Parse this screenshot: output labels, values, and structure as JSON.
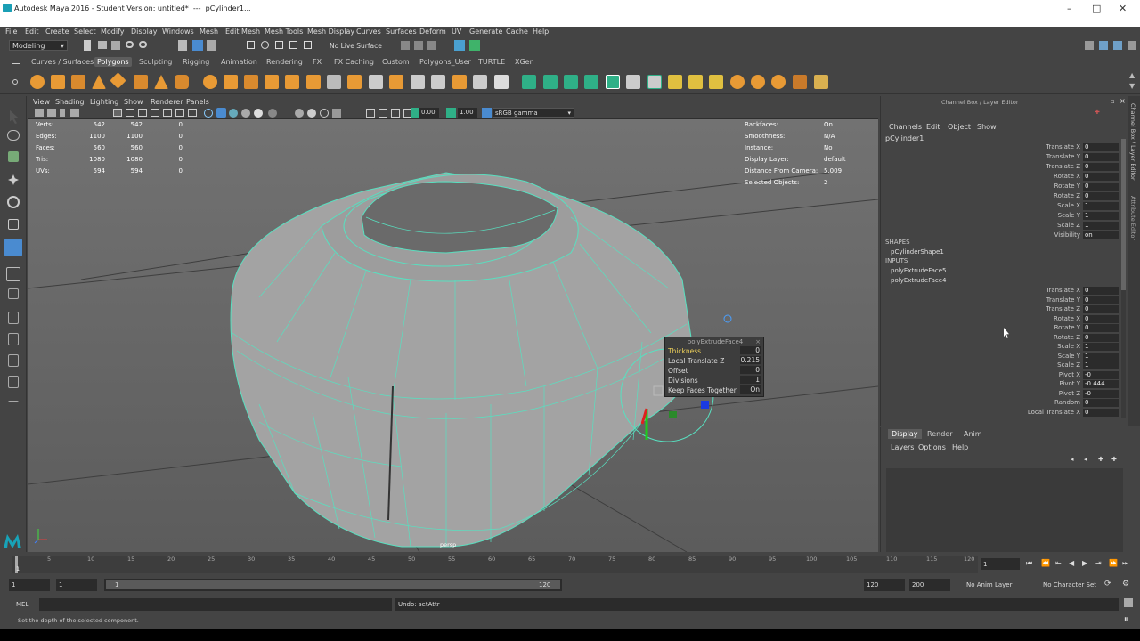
{
  "title": {
    "app": "Autodesk Maya 2016 - Student Version: untitled*",
    "sep": "---",
    "object": "pCylinder1..."
  },
  "window_controls": {
    "min": "–",
    "max": "□",
    "close": "✕"
  },
  "menu": [
    "File",
    "Edit",
    "Create",
    "Select",
    "Modify",
    "Display",
    "Windows",
    "Mesh",
    "Edit Mesh",
    "Mesh Tools",
    "Mesh Display",
    "Curves",
    "Surfaces",
    "Deform",
    "UV",
    "Generate",
    "Cache",
    "Help"
  ],
  "status": {
    "mode": "Modeling",
    "live": "No Live Surface"
  },
  "shelf_tabs": [
    "Curves / Surfaces",
    "Polygons",
    "Sculpting",
    "Rigging",
    "Animation",
    "Rendering",
    "FX",
    "FX Caching",
    "Custom",
    "Polygons_User",
    "TURTLE",
    "XGen"
  ],
  "viewport_menu": [
    "View",
    "Shading",
    "Lighting",
    "Show",
    "Renderer",
    "Panels"
  ],
  "viewport_toolbar": {
    "val1": "0.00",
    "val2": "1.00",
    "colorspace": "sRGB gamma"
  },
  "hud_left": [
    {
      "label": "Verts:",
      "a": "542",
      "b": "542",
      "c": "0"
    },
    {
      "label": "Edges:",
      "a": "1100",
      "b": "1100",
      "c": "0"
    },
    {
      "label": "Faces:",
      "a": "560",
      "b": "560",
      "c": "0"
    },
    {
      "label": "Tris:",
      "a": "1080",
      "b": "1080",
      "c": "0"
    },
    {
      "label": "UVs:",
      "a": "594",
      "b": "594",
      "c": "0"
    }
  ],
  "hud_right": [
    {
      "label": "Backfaces:",
      "value": "On"
    },
    {
      "label": "Smoothness:",
      "value": "N/A"
    },
    {
      "label": "Instance:",
      "value": "No"
    },
    {
      "label": "Display Layer:",
      "value": "default"
    },
    {
      "label": "Distance From Camera:",
      "value": "5.009"
    },
    {
      "label": "Selected Objects:",
      "value": "2"
    }
  ],
  "camera_label": "persp",
  "popup": {
    "title": "polyExtrudeFace4",
    "rows": [
      {
        "label": "Thickness",
        "value": "0"
      },
      {
        "label": "Local Translate Z",
        "value": "0.215"
      },
      {
        "label": "Offset",
        "value": "0"
      },
      {
        "label": "Divisions",
        "value": "1"
      },
      {
        "label": "Keep Faces Together",
        "value": "On"
      }
    ]
  },
  "channel_box": {
    "header": "Channel Box / Layer Editor",
    "menu": [
      "Channels",
      "Edit",
      "Object",
      "Show"
    ],
    "object": "pCylinder1",
    "transform": [
      {
        "label": "Translate X",
        "value": "0"
      },
      {
        "label": "Translate Y",
        "value": "0"
      },
      {
        "label": "Translate Z",
        "value": "0"
      },
      {
        "label": "Rotate X",
        "value": "0"
      },
      {
        "label": "Rotate Y",
        "value": "0"
      },
      {
        "label": "Rotate Z",
        "value": "0"
      },
      {
        "label": "Scale X",
        "value": "1"
      },
      {
        "label": "Scale Y",
        "value": "1"
      },
      {
        "label": "Scale Z",
        "value": "1"
      },
      {
        "label": "Visibility",
        "value": "on"
      }
    ],
    "shapes_label": "SHAPES",
    "shape": "pCylinderShape1",
    "inputs_label": "INPUTS",
    "inputs": [
      "polyExtrudeFace5",
      "polyExtrudeFace4"
    ],
    "input_attrs": [
      {
        "label": "Translate X",
        "value": "0"
      },
      {
        "label": "Translate Y",
        "value": "0"
      },
      {
        "label": "Translate Z",
        "value": "0"
      },
      {
        "label": "Rotate X",
        "value": "0"
      },
      {
        "label": "Rotate Y",
        "value": "0"
      },
      {
        "label": "Rotate Z",
        "value": "0"
      },
      {
        "label": "Scale X",
        "value": "1"
      },
      {
        "label": "Scale Y",
        "value": "1"
      },
      {
        "label": "Scale Z",
        "value": "1"
      },
      {
        "label": "Pivot X",
        "value": "-0"
      },
      {
        "label": "Pivot Y",
        "value": "-0.444"
      },
      {
        "label": "Pivot Z",
        "value": "-0"
      },
      {
        "label": "Random",
        "value": "0"
      },
      {
        "label": "Local Translate X",
        "value": "0"
      }
    ]
  },
  "side_tabs": [
    "Channel Box / Layer Editor",
    "Attribute Editor"
  ],
  "layer_editor": {
    "tabs": [
      "Display",
      "Render",
      "Anim"
    ],
    "menu": [
      "Layers",
      "Options",
      "Help"
    ]
  },
  "timeline": {
    "ticks": [
      "1",
      "5",
      "10",
      "15",
      "20",
      "25",
      "30",
      "35",
      "40",
      "45",
      "50",
      "55",
      "60",
      "65",
      "70",
      "75",
      "80",
      "85",
      "90",
      "95",
      "100",
      "105",
      "110",
      "115",
      "120"
    ],
    "current": "1"
  },
  "range": {
    "start": "1",
    "inner_start": "1",
    "slider_start": "1",
    "slider_end": "120",
    "end": "120",
    "anim_end": "200",
    "anim_layer": "No Anim Layer",
    "char_set": "No Character Set"
  },
  "command": {
    "lang": "MEL",
    "result": "Undo: setAttr"
  },
  "help_line": "Set the depth of the selected component."
}
